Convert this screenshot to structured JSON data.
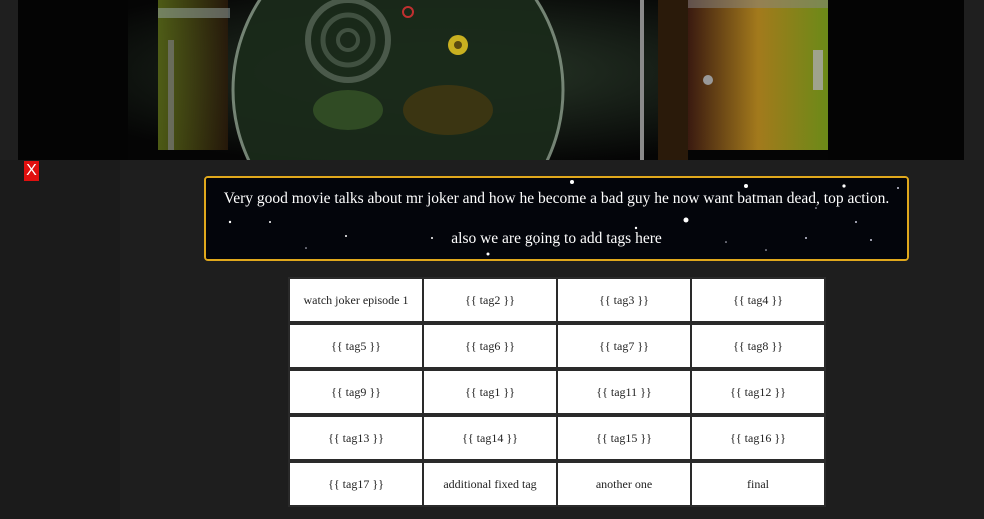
{
  "close_button": {
    "label": "X"
  },
  "banner": {
    "image": "drum-kit-photo"
  },
  "description": {
    "line1": "Very good movie talks about mr joker and how he become a bad guy he now want batman dead, top action.",
    "line2": "also we are going to add tags here"
  },
  "tags": [
    "watch joker episode 1",
    "{{ tag2 }}",
    "{{ tag3 }}",
    "{{ tag4 }}",
    "{{ tag5 }}",
    "{{ tag6 }}",
    "{{ tag7 }}",
    "{{ tag8 }}",
    "{{ tag9 }}",
    "{{ tag1 }}",
    "{{ tag11 }}",
    "{{ tag12 }}",
    "{{ tag13 }}",
    "{{ tag14 }}",
    "{{ tag15 }}",
    "{{ tag16 }}",
    "{{ tag17 }}",
    "additional fixed tag",
    "another one",
    "final"
  ],
  "colors": {
    "page_bg": "#1e1e1e",
    "close_bg": "#e0100f",
    "frame_border": "#e0a81c"
  }
}
